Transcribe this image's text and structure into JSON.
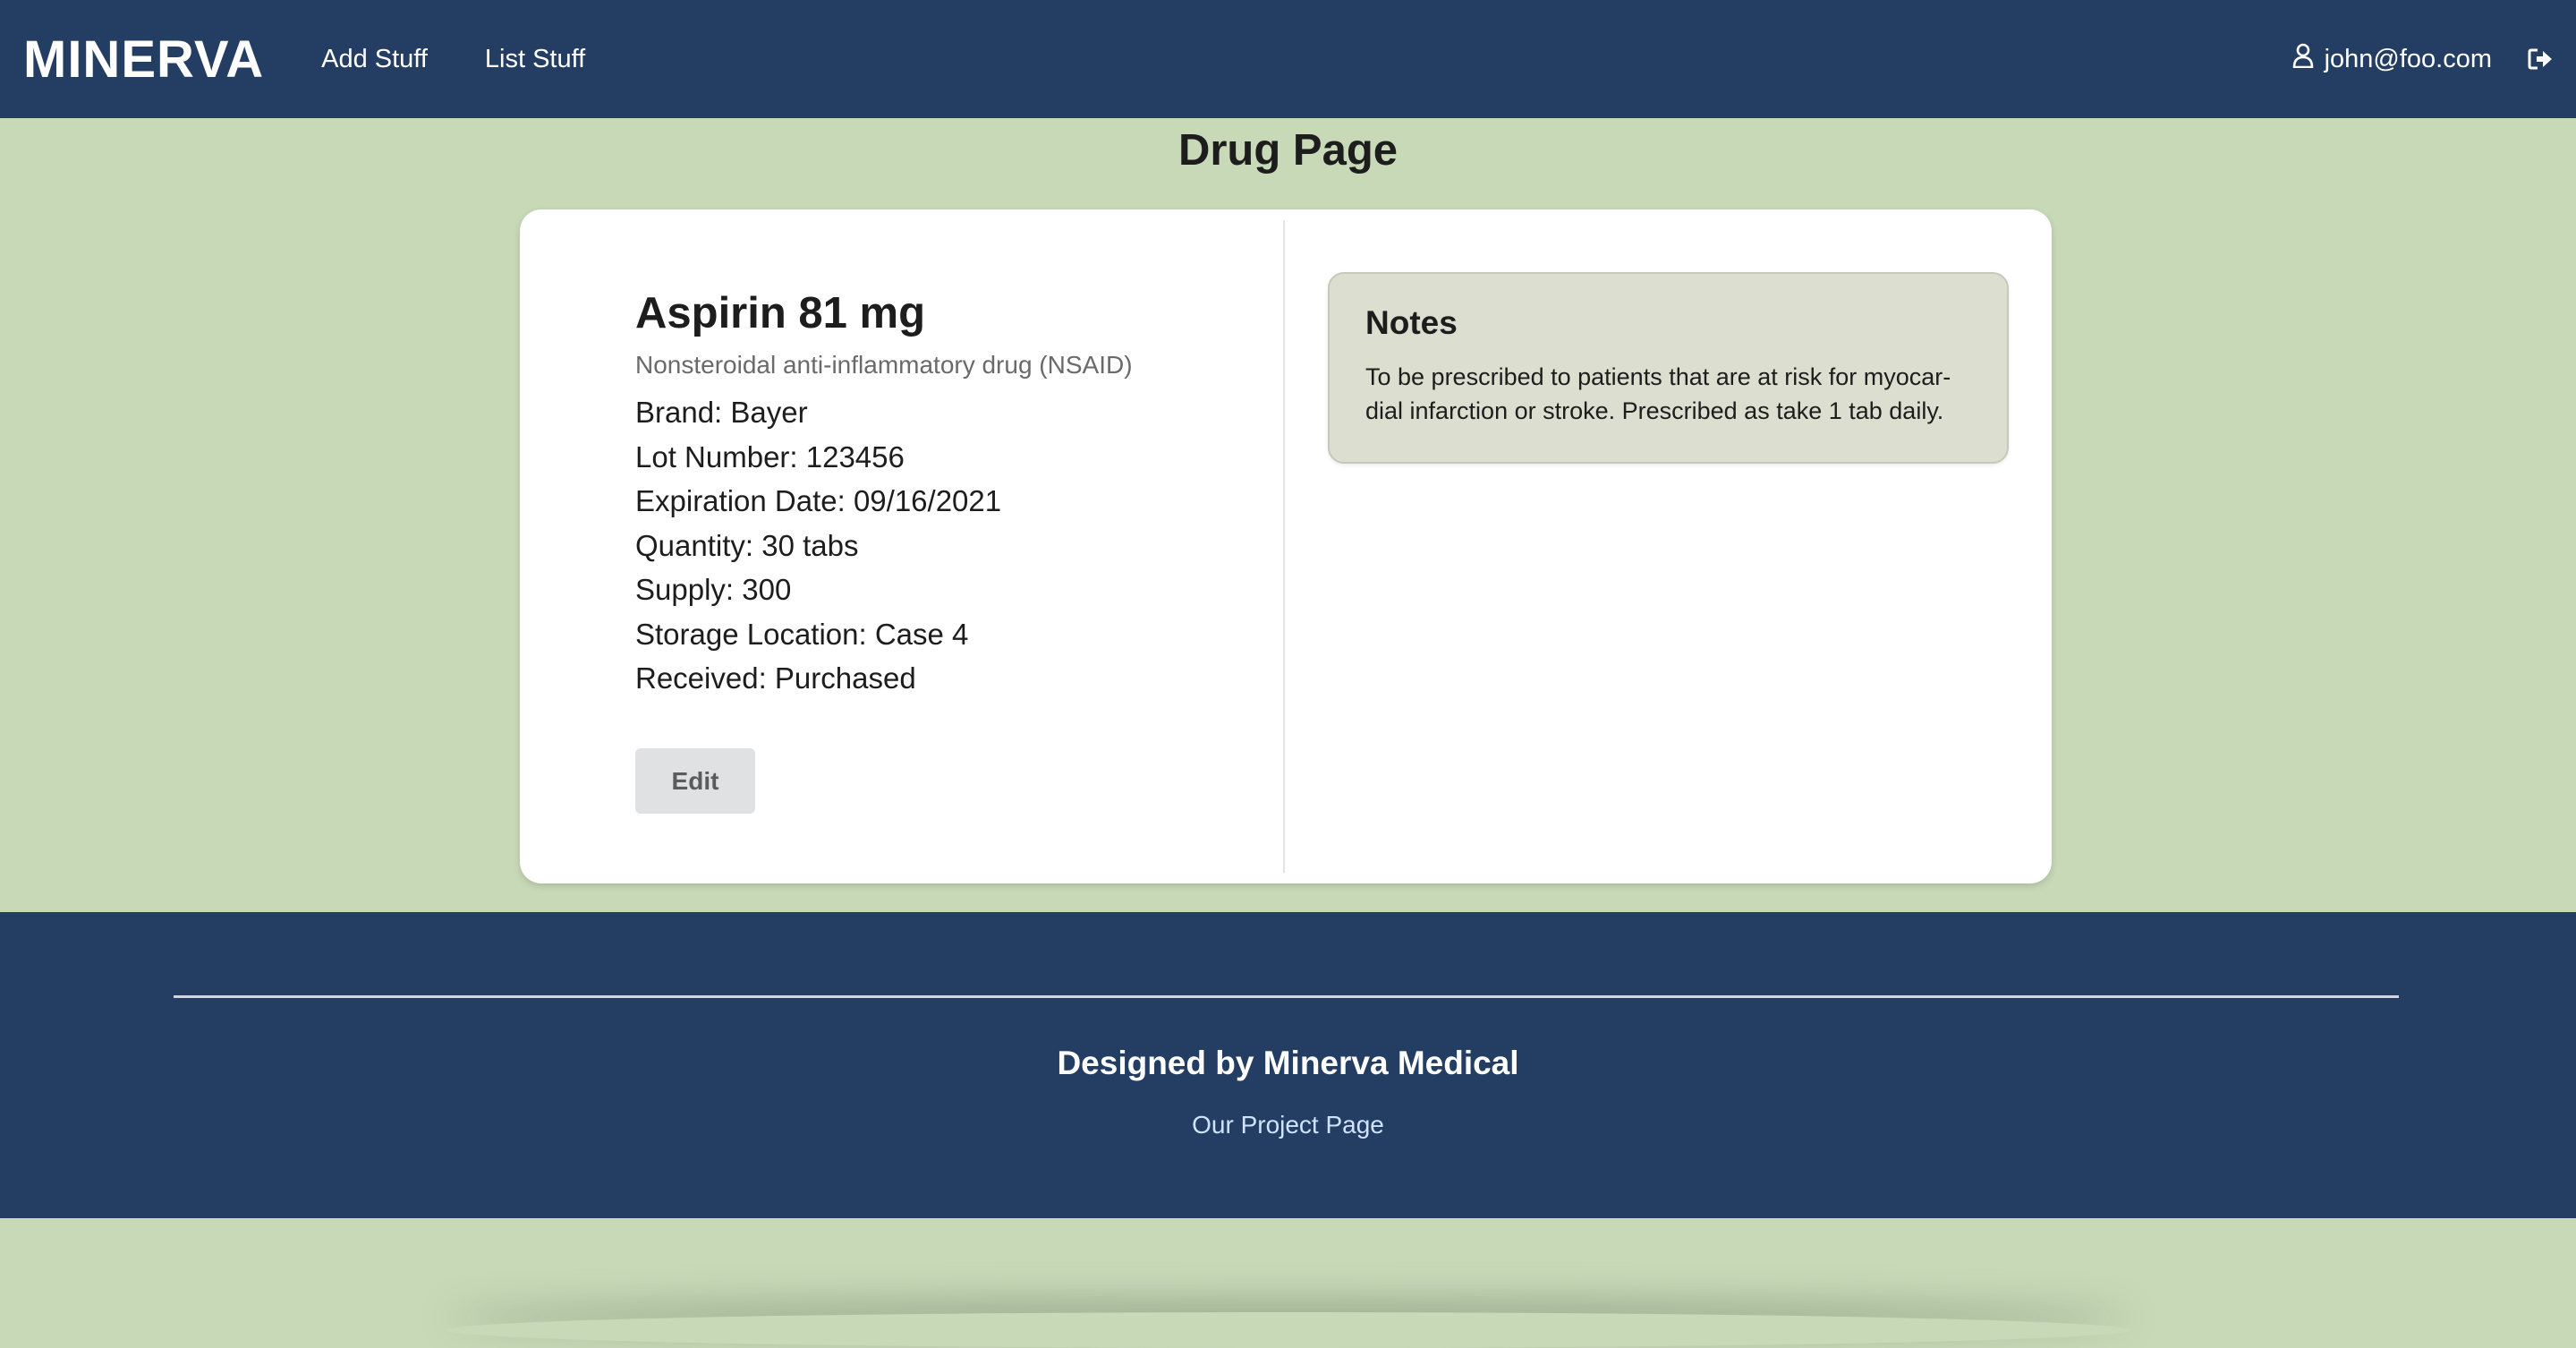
{
  "navbar": {
    "brand": "MINERVA",
    "links": [
      {
        "label": "Add Stuff"
      },
      {
        "label": "List Stuff"
      }
    ],
    "user_email": "john@foo.com"
  },
  "page": {
    "title": "Drug Page"
  },
  "drug": {
    "name": "Aspirin 81 mg",
    "category": "Nonsteroidal anti-inflammatory drug (NSAID)",
    "details": [
      "Brand: Bayer",
      "Lot Number: 123456",
      "Expiration Date: 09/16/2021",
      "Quantity: 30 tabs",
      "Supply: 300",
      "Storage Location: Case 4",
      "Received: Purchased"
    ],
    "edit_label": "Edit"
  },
  "notes": {
    "title": "Notes",
    "text": "To be prescribed to patients that are at risk for myocar-dial infarction or stroke. Prescribed as take 1 tab daily."
  },
  "footer": {
    "title": "Designed by Minerva Medical",
    "link_label": "Our Project Page"
  },
  "colors": {
    "navbar_bg": "#243d63",
    "page_bg": "#c8d9b8",
    "card_bg": "#ffffff",
    "notes_bg": "#dcdecf",
    "footer_link": "#cfe3ff"
  },
  "icons": {
    "user": "user-icon",
    "signout": "sign-out-icon"
  }
}
